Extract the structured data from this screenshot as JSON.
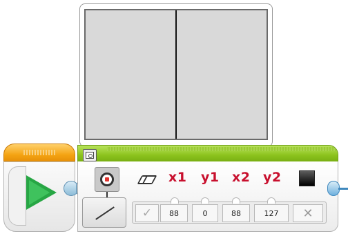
{
  "display_block": {
    "parameters": {
      "x1": {
        "label": "x1",
        "value": "88"
      },
      "y1": {
        "label": "y1",
        "value": "0"
      },
      "x2": {
        "label": "x2",
        "value": "88"
      },
      "y2": {
        "label": "y2",
        "value": "127"
      }
    },
    "icons": {
      "mode": "display-eye-icon",
      "submode": "line-icon",
      "clear": "eraser-icon",
      "color": "black-square-icon",
      "preview_toggle": "preview-icon",
      "start": "play-icon",
      "check": "check-icon",
      "close": "close-icon"
    },
    "colors": {
      "param_label": "#c8102e",
      "start_play": "#27a644",
      "block_top": "#8bc21c",
      "start_top": "#f4a312",
      "wire": "#6fb0de"
    }
  },
  "controls": {
    "check_glyph": "✓",
    "close_glyph": "✕"
  }
}
